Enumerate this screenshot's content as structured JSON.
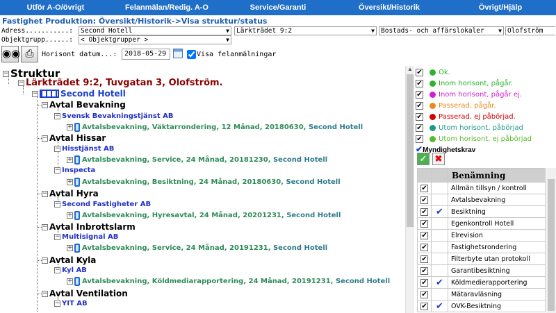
{
  "nav": [
    "Utför A-O/övrigt",
    "Felanmälan/Redig. A-O",
    "Service/Garanti",
    "Översikt/Historik",
    "Övrigt/Hjälp"
  ],
  "breadcrumb": "Fastighet Produktion: Översikt/Historik->Visa struktur/status",
  "filters": {
    "adress_label": "Adress...........:",
    "adress_value": "Second Hotell",
    "property_value": "Lärkträdet 9:2",
    "type_value": "Bostads- och affärslokaler",
    "city_value": "Olofström",
    "objektgrupp_label": "Objektgrupp......:",
    "objektgrupp_value": "< Objektgrupper >"
  },
  "toolbar": {
    "datum_label": "Horisont datum...:",
    "datum_value": "2018-05-29",
    "visa_label": "Visa felanmälningar"
  },
  "tree": {
    "root": "Struktur",
    "property": "Lärkträdet 9:2, Tuvgatan 3, Olofström.",
    "building": "Second Hotell",
    "groups": [
      {
        "name": "Avtal Bevakning",
        "supplier": "Svensk Bevakningstjänst AB",
        "item": "Avtalsbevakning, Väktarrondering, 12 Månad, 20180630, ",
        "hotel": "Second Hotell"
      },
      {
        "name": "Avtal Hissar",
        "supplier": "Hisstjänst AB",
        "item": "Avtalsbevakning, Service, 24 Månad, 20181230, ",
        "hotel": "Second Hotell",
        "supplier2": "Inspecta",
        "item2": "Avtalsbevakning, Besiktning, 24 Månad, 20180630, ",
        "hotel2": "Second Hotell"
      },
      {
        "name": "Avtal Hyra",
        "supplier": "Second Fastigheter AB",
        "item": "Avtalsbevakning, Hyresavtal, 24 Månad, 20201231, ",
        "hotel": "Second Hotell"
      },
      {
        "name": "Avtal Inbrottslarm",
        "supplier": "Multisignal AB",
        "item": "Avtalsbevakning, Service, 24 Månad, 20191231, ",
        "hotel": "Second Hotell"
      },
      {
        "name": "Avtal Kyla",
        "supplier": "Kyl AB",
        "item": "Avtalsbevakning, Köldmediarapportering, 24 Månad, 20191231, ",
        "hotel": "Second Hotell"
      },
      {
        "name": "Avtal Ventilation",
        "supplier": "YIT AB"
      }
    ]
  },
  "legend": [
    {
      "label": "Ok.",
      "color": "#2db32d",
      "dot": "#2db32d"
    },
    {
      "label": "Inom horisont, pågår.",
      "color": "#2db32d",
      "dot": "#2db32d"
    },
    {
      "label": "Inom horisont, pågår ej.",
      "color": "#d21fd2",
      "dot": "#d21fd2"
    },
    {
      "label": "Passerad, pågår.",
      "color": "#e8891a",
      "dot": "#e8891a"
    },
    {
      "label": "Passerad, ej påbörjad.",
      "color": "#d40000",
      "dot": "#d40000"
    },
    {
      "label": "Utom horisont, påbörjad",
      "color": "#1a9a8a",
      "dot": "#1a9a8a"
    },
    {
      "label": "Utom horisont, ej påbörjad",
      "color": "#5ab82e",
      "dot": "#5ab82e"
    }
  ],
  "myndighetskrav": "Myndighetskrav",
  "benamning_header": "Benämning",
  "benamning": [
    {
      "label": "Allmän tillsyn / kontroll",
      "mark": ""
    },
    {
      "label": "Avtalsbevakning",
      "mark": ""
    },
    {
      "label": "Besiktning",
      "mark": "✔"
    },
    {
      "label": "Egenkontroll Hotell",
      "mark": ""
    },
    {
      "label": "Elrevision",
      "mark": ""
    },
    {
      "label": "Fastighetsrondering",
      "mark": ""
    },
    {
      "label": "Filterbyte utan protokoll",
      "mark": ""
    },
    {
      "label": "Garantibesiktning",
      "mark": ""
    },
    {
      "label": "Köldmedierapportering",
      "mark": "✔"
    },
    {
      "label": "Mätaravläsning",
      "mark": ""
    },
    {
      "label": "OVK-Besiktning",
      "mark": "✔"
    }
  ]
}
